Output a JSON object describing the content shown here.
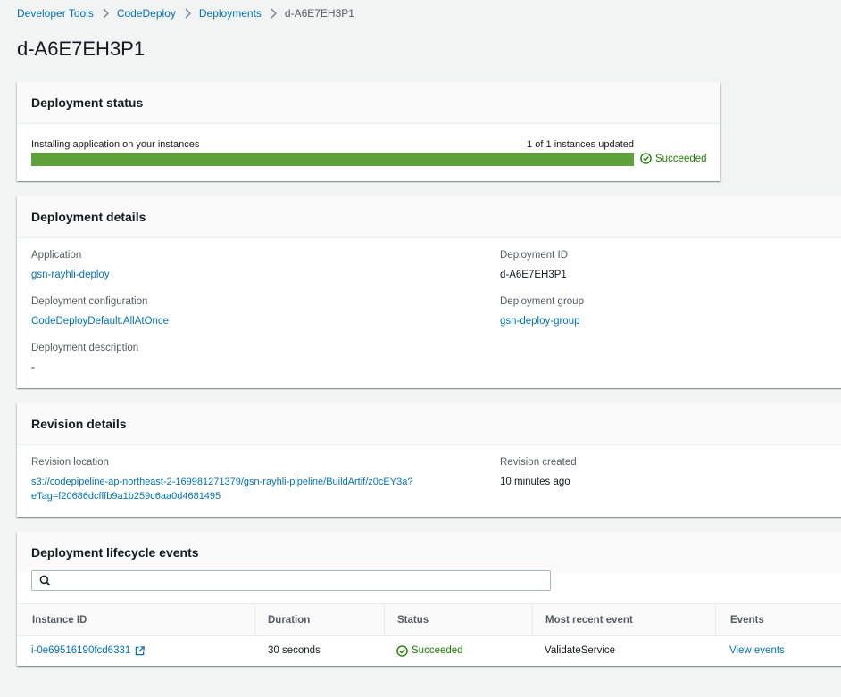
{
  "breadcrumb": {
    "items": [
      "Developer Tools",
      "CodeDeploy",
      "Deployments"
    ],
    "current": "d-A6E7EH3P1"
  },
  "page_title": "d-A6E7EH3P1",
  "status": {
    "title": "Deployment status",
    "message": "Installing application on your instances",
    "instances_updated": "1 of 1 instances updated",
    "progress_percent": 100,
    "result": "Succeeded",
    "colors": {
      "progress": "#5fa23c",
      "success": "#1d8102"
    }
  },
  "details": {
    "title": "Deployment details",
    "application_label": "Application",
    "application_value": "gsn-rayhli-deploy",
    "deployment_id_label": "Deployment ID",
    "deployment_id_value": "d-A6E7EH3P1",
    "config_label": "Deployment configuration",
    "config_value": "CodeDeployDefault.AllAtOnce",
    "group_label": "Deployment group",
    "group_value": "gsn-deploy-group",
    "description_label": "Deployment description",
    "description_value": "-"
  },
  "revision": {
    "title": "Revision details",
    "location_label": "Revision location",
    "location_line1": "s3://codepipeline-ap-northeast-2-169981271379/gsn-rayhli-pipeline/BuildArtif/z0cEY3a?",
    "location_line2": "eTag=f20686dcfffb9a1b259c6aa0d4681495",
    "created_label": "Revision created",
    "created_value": "10 minutes ago"
  },
  "lifecycle": {
    "title": "Deployment lifecycle events",
    "search_value": "",
    "columns": [
      "Instance ID",
      "Duration",
      "Status",
      "Most recent event",
      "Events"
    ],
    "rows": [
      {
        "instance_id": "i-0e69516190fcd6331",
        "duration": "30 seconds",
        "status": "Succeeded",
        "recent_event": "ValidateService",
        "events_link": "View events"
      }
    ]
  },
  "icons": [
    "chevron-right-icon",
    "check-circle-icon",
    "search-icon",
    "external-link-icon"
  ]
}
